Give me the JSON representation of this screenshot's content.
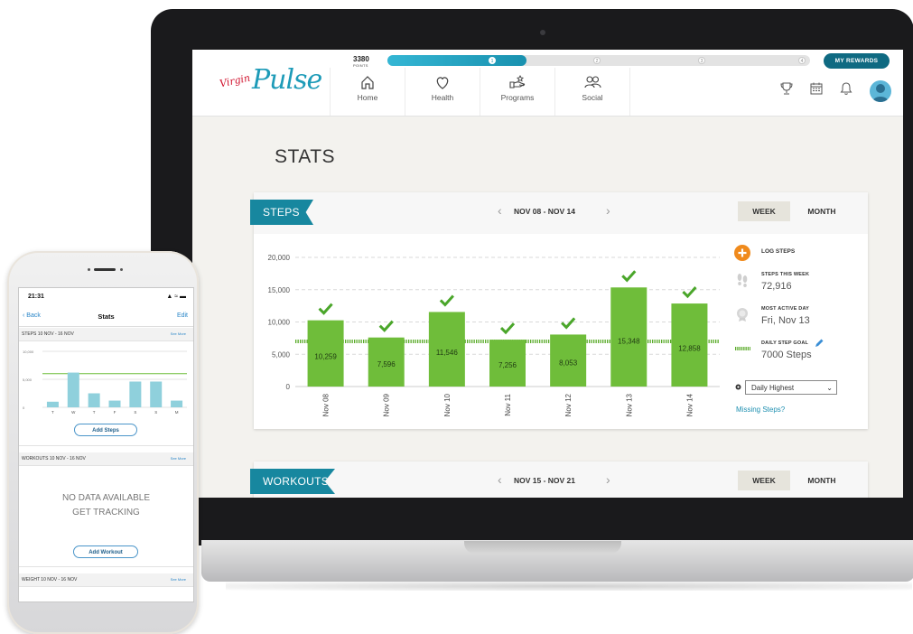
{
  "web": {
    "points_value": "3380",
    "points_label": "POINTS",
    "progress_fraction": 0.33,
    "levels": [
      "1",
      "2",
      "3",
      "4"
    ],
    "rewards_label": "MY REWARDS",
    "nav": [
      {
        "label": "Home",
        "icon": "home-icon"
      },
      {
        "label": "Health",
        "icon": "heart-icon"
      },
      {
        "label": "Programs",
        "icon": "programs-icon"
      },
      {
        "label": "Social",
        "icon": "people-icon"
      }
    ],
    "page_title": "STATS",
    "steps_card": {
      "title": "STEPS",
      "date_range": "NOV 08 - NOV 14",
      "week_label": "WEEK",
      "month_label": "MONTH",
      "log_steps_label": "LOG STEPS",
      "steps_week_label": "STEPS THIS WEEK",
      "steps_week_value": "72,916",
      "most_active_label": "MOST ACTIVE DAY",
      "most_active_value": "Fri, Nov 13",
      "goal_label": "DAILY STEP GOAL",
      "goal_value": "7000 Steps",
      "dropdown_value": "Daily Highest",
      "missing_link": "Missing Steps?"
    },
    "workouts_card": {
      "title": "WORKOUTS",
      "date_range": "NOV 15 - NOV 21",
      "week_label": "WEEK",
      "month_label": "MONTH"
    },
    "accent": "#17879f",
    "bar_color": "#6fbd3a"
  },
  "chart_data": [
    {
      "type": "bar",
      "categories": [
        "Nov 08",
        "Nov 09",
        "Nov 10",
        "Nov 11",
        "Nov 12",
        "Nov 13",
        "Nov 14"
      ],
      "values": [
        10259,
        7596,
        11546,
        7256,
        8053,
        15348,
        12858
      ],
      "value_labels": [
        "10,259",
        "7,596",
        "11,546",
        "7,256",
        "8,053",
        "15,348",
        "12,858"
      ],
      "ytick_labels": [
        "0",
        "5,000",
        "10,000",
        "15,000",
        "20,000"
      ],
      "ylim": [
        0,
        20000
      ],
      "goal_line": 7000,
      "grid": true
    },
    {
      "type": "bar",
      "categories": [
        "T",
        "W",
        "T",
        "F",
        "S",
        "S",
        "M"
      ],
      "values": [
        1000,
        6200,
        2500,
        1200,
        4600,
        4600,
        1200
      ],
      "ytick_labels": [
        "0",
        "5,000",
        "10,000"
      ],
      "ylim": [
        0,
        10000
      ],
      "goal_line": 6000,
      "grid": true
    }
  ],
  "phone": {
    "time": "21:31",
    "status_icons": "▲ ≈ ▬",
    "back_label": "Back",
    "title": "Stats",
    "edit_label": "Edit",
    "steps_section": "STEPS  10 NOV - 16 NOV",
    "see_more": "See More",
    "add_steps": "Add Steps",
    "workouts_section": "WORKOUTS  10 NOV - 16 NOV",
    "no_data_line1": "NO DATA AVAILABLE",
    "no_data_line2": "GET TRACKING",
    "add_workout": "Add Workout",
    "weight_section": "WEIGHT  10 NOV - 16 NOV",
    "bar_color": "#8fd0dc",
    "highlight_color": "#6fbd3a"
  }
}
